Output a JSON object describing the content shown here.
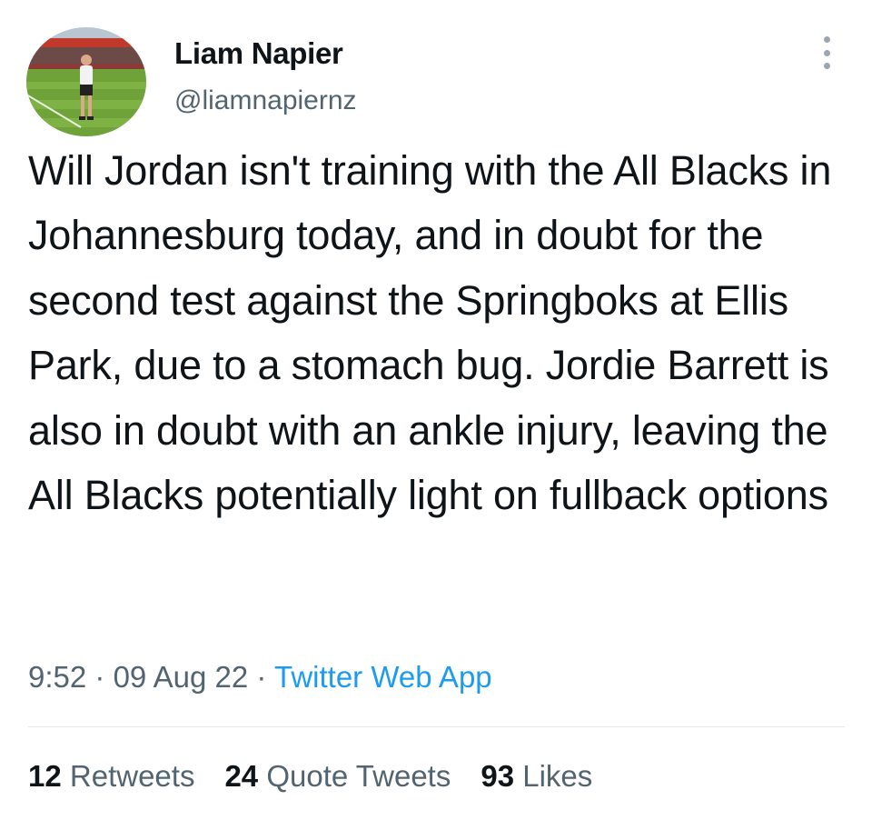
{
  "author": {
    "display_name": "Liam Napier",
    "handle": "@liamnapiernz"
  },
  "tweet": {
    "text": "Will Jordan isn't training with the All Blacks in Johannesburg today, and in doubt for the second test against the Springboks at Ellis Park, due to a stomach bug. Jordie Barrett is also in doubt with an ankle injury, leaving the All Blacks potentially light on fullback options",
    "time": "9:52",
    "date": "09 Aug 22",
    "separator": "·",
    "source": "Twitter Web App"
  },
  "stats": {
    "retweets_count": "12",
    "retweets_label": "Retweets",
    "quotes_count": "24",
    "quotes_label": "Quote Tweets",
    "likes_count": "93",
    "likes_label": "Likes"
  },
  "icons": {
    "more": "more-vertical-icon"
  },
  "colors": {
    "text_primary": "#0f1419",
    "text_secondary": "#536471",
    "link": "#1d9bf0",
    "divider": "#e4e8eb"
  }
}
